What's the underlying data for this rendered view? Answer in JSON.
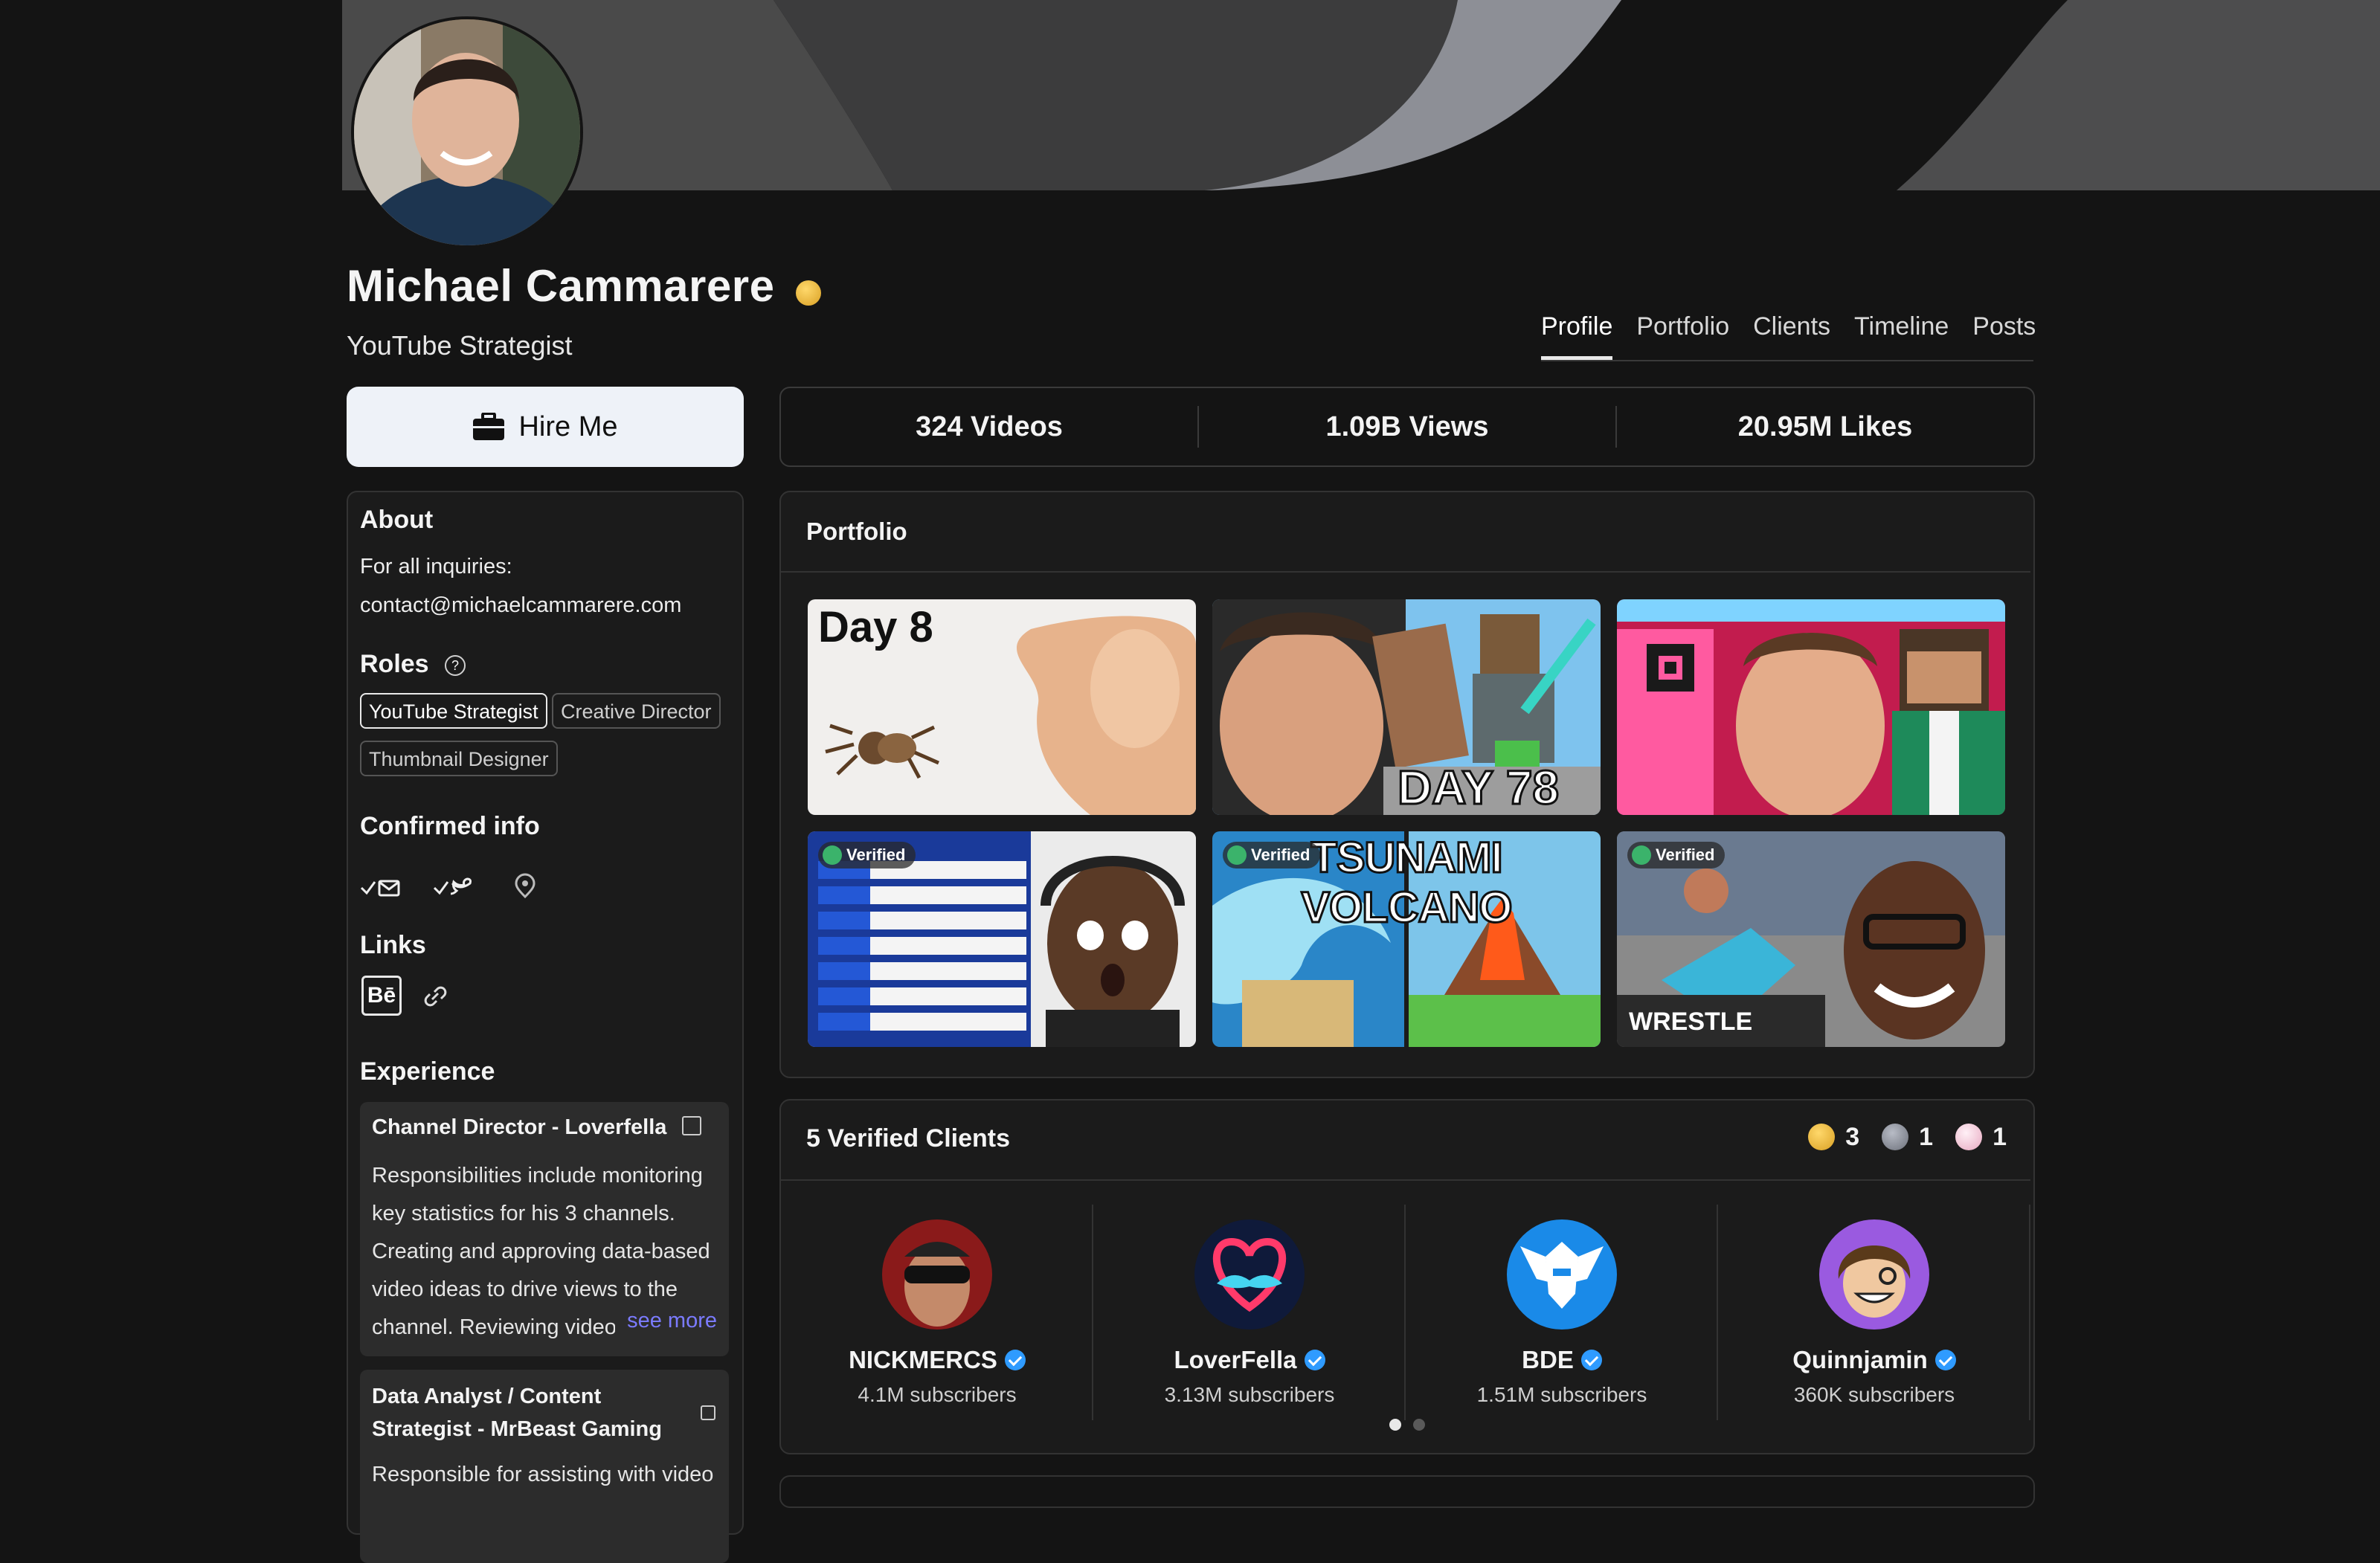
{
  "profile": {
    "name": "Michael Cammarere",
    "title": "YouTube Strategist"
  },
  "tabs": [
    {
      "label": "Profile",
      "active": true
    },
    {
      "label": "Portfolio"
    },
    {
      "label": "Clients"
    },
    {
      "label": "Timeline"
    },
    {
      "label": "Posts"
    }
  ],
  "hire": {
    "label": "Hire Me",
    "icon": "briefcase-icon"
  },
  "stats": [
    "324 Videos",
    "1.09B Views",
    "20.95M Likes"
  ],
  "about": {
    "heading": "About",
    "line1": "For all inquiries:",
    "line2": "contact@michaelcammarere.com"
  },
  "roles": {
    "heading": "Roles",
    "items": [
      "YouTube Strategist",
      "Creative Director",
      "Thumbnail Designer"
    ]
  },
  "confirmed": {
    "heading": "Confirmed info"
  },
  "links": {
    "heading": "Links",
    "behance": "Bē"
  },
  "experience": {
    "heading": "Experience",
    "items": [
      {
        "title": "Channel Director - Loverfella",
        "body": "Responsibilities include monitoring key statistics for his 3 channels. Creating and approving data-based video ideas to drive views to the channel. Reviewing video",
        "more": "see more"
      },
      {
        "title": "Data Analyst / Content Strategist - MrBeast Gaming",
        "body": "Responsible for assisting with video"
      }
    ]
  },
  "portfolio": {
    "heading": "Portfolio",
    "thumbs": [
      {
        "text": "Day 8",
        "verified": false
      },
      {
        "text": "DAY 78",
        "verified": false
      },
      {
        "text": "",
        "verified": false
      },
      {
        "text": "",
        "verified": true
      },
      {
        "text": "TSUNAMI VOLCANO",
        "verified": true
      },
      {
        "text": "WRESTLE",
        "verified": true
      }
    ],
    "badge_label": "Verified"
  },
  "clients": {
    "heading": "5 Verified Clients",
    "medals": [
      {
        "color": "#e8b53a",
        "count": "3"
      },
      {
        "color": "#8c8f99",
        "count": "1"
      },
      {
        "color": "#f2c6d6",
        "count": "1"
      }
    ],
    "items": [
      {
        "name": "NICKMERCS",
        "subs": "4.1M subscribers"
      },
      {
        "name": "LoverFella",
        "subs": "3.13M subscribers"
      },
      {
        "name": "BDE",
        "subs": "1.51M subscribers"
      },
      {
        "name": "Quinnjamin",
        "subs": "360K subscribers"
      }
    ]
  }
}
